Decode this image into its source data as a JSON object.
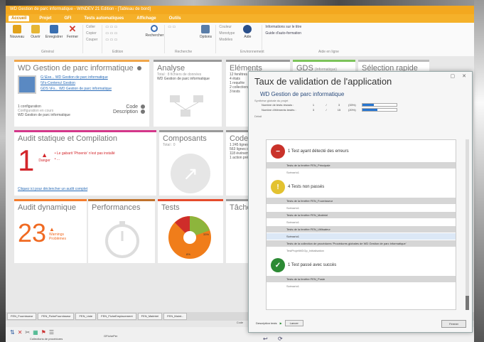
{
  "app": {
    "title": "WD Gestion de parc informatique - WINDEV 21 Edition - [Tableau de bord]",
    "menu_tabs": [
      "Accueil",
      "Projet",
      "GFI",
      "Tests automatiques",
      "Affichage",
      "Outils"
    ]
  },
  "ribbon": {
    "buttons": [
      {
        "label": "Nouveau",
        "icon": "new-document-icon",
        "color": "#e2a21a"
      },
      {
        "label": "Ouvrir",
        "icon": "folder-open-icon",
        "color": "#e6b635"
      },
      {
        "label": "Enregistrer",
        "icon": "save-icon",
        "color": "#3a6fb0"
      },
      {
        "label": "Fermer",
        "icon": "close-icon",
        "color": "#d23a2f"
      },
      {
        "label": "Rechercher",
        "icon": "search-icon",
        "color": "#3d6fb3"
      },
      {
        "label": "Options",
        "icon": "options-icon",
        "color": "#5a7da8"
      },
      {
        "label": "Aide",
        "icon": "help-icon",
        "color": "#2a4f8a"
      }
    ],
    "edit_group": [
      "Coller",
      "Copier",
      "Couper"
    ],
    "env_group": [
      "Couleur",
      "Monotype",
      "Modèles"
    ],
    "help_group": [
      "Informations sur le titre",
      "Guide d'auto-formation"
    ],
    "group_labels": [
      "Général",
      "Edition",
      "Recherche",
      "Environnement",
      "Aide en ligne"
    ]
  },
  "dashboard": {
    "project_tile": {
      "title": "WD Gestion de parc informatique",
      "links": [
        "G:\\Exe... WD Gestion de parc informatique",
        "\\\\Fs-Contenu\\ Gestion",
        "GDS \\\\Fs... WD Gestion de parc informatique"
      ],
      "config_label": "1 configuration",
      "config_sub": "Configuration en cours",
      "config_name": "WD Gestion de parc informatique",
      "code_label": "Code",
      "description_label": "Description"
    },
    "analyse_tile": {
      "title": "Analyse",
      "subtitle": "Total : 8 fichiers de données",
      "line": "WD Gestion de parc informatique"
    },
    "elements_tile": {
      "title": "Eléments",
      "lines": [
        "12 fenêtres",
        "4 états",
        "1 requête",
        "2 collections",
        "3 tests"
      ]
    },
    "gds_tile": {
      "title": "GDS",
      "subtitle": "(Informatique)"
    },
    "selection_tile": {
      "title": "Sélection rapide"
    },
    "audit_tile": {
      "title": "Audit statique et Compilation",
      "count": "1",
      "count_label": "Danger",
      "bullets": [
        "Le gabarit 'Phoenix' n'est pas installé",
        "..."
      ],
      "link": "Cliquez ici pour déclencher un audit complet"
    },
    "composants_tile": {
      "title": "Composants",
      "subtitle": "Total : 0"
    },
    "code_tile": {
      "title": "Code",
      "lines": [
        "1 245 lignes de code",
        "563 lignes de commentaires",
        "118 événements",
        "1 action prédéfinie"
      ]
    },
    "audit_dyn_tile": {
      "title": "Audit dynamique",
      "count": "23",
      "label": "Warnings",
      "sublabel": "Problèmes"
    },
    "perf_tile": {
      "title": "Performances"
    },
    "tests_tile": {
      "title": "Tests",
      "pass_label": "33%",
      "fail_label": "8%"
    },
    "taches_tile": {
      "title": "Tâches"
    }
  },
  "dialog": {
    "title": "Taux de validation de l'application",
    "subtitle": "WD Gestion de parc informatique",
    "section_summary": "Synthèse globale du projet",
    "rows": [
      {
        "label": "Nombre de tests réussis :",
        "a": "1",
        "sep": "/",
        "b": "3",
        "pct": "(33%)",
        "fill": 0.33
      },
      {
        "label": "Nombre d'éléments testés :",
        "a": "3",
        "sep": "/",
        "b": "15",
        "pct": "(20%)",
        "fill": 0.45
      }
    ],
    "section_detail": "Détail",
    "groups": [
      {
        "heading": "1 Test ayant détecté des erreurs",
        "icon": "error-icon",
        "color": "#c9322a",
        "items": [
          {
            "text": "Tests de la fenêtre FEN_Principale",
            "style": "gray"
          },
          {
            "text": "Scénario1",
            "style": "plain"
          }
        ]
      },
      {
        "heading": "4 Tests non passés",
        "icon": "warning-icon",
        "color": "#e3c230",
        "items": [
          {
            "text": "Tests de la fenêtre FEN_Fournisseur",
            "style": "gray"
          },
          {
            "text": "Scénario1",
            "style": "plain"
          },
          {
            "text": "Tests de la fenêtre FEN_Matériel",
            "style": "gray"
          },
          {
            "text": "Scénario1",
            "style": "plain"
          },
          {
            "text": "Tests de la fenêtre FEN_Utilisateur",
            "style": "gray"
          },
          {
            "text": "Scénario1",
            "style": "blue"
          },
          {
            "text": "Tests de la collection de procédures 'Procédures globales de WD Gestion de parc informatique'",
            "style": "gray"
          },
          {
            "text": "TestProjetWDGp_Initialisation",
            "style": "plain"
          }
        ]
      },
      {
        "heading": "1 Test passé avec succès",
        "icon": "success-icon",
        "color": "#2c8a34",
        "items": [
          {
            "text": "Tests de la fenêtre FEN_Poste",
            "style": "gray"
          },
          {
            "text": "Scénario1",
            "style": "plain"
          }
        ]
      }
    ],
    "footer_text": "Description tests",
    "footer_button": "Lancer",
    "close_button": "Fermer"
  },
  "doc_tabs": [
    "FEN_Fournisseur",
    "FEN_FicheFournisseur",
    "FEN_Liste",
    "FEN_FicheEmplacement",
    "FEN_Matériel",
    "FEN_Maint..."
  ],
  "status": {
    "center": "Code"
  },
  "bottom": {
    "label1": "Collections de procédures",
    "label2": "GFIchePer"
  }
}
